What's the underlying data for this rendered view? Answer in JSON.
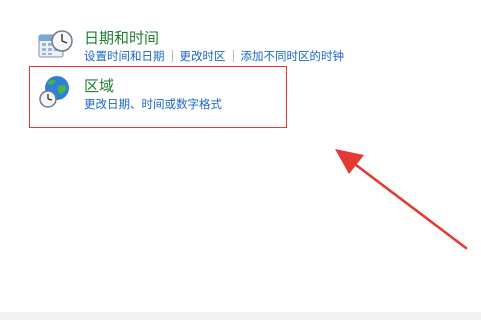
{
  "datetime": {
    "title": "日期和时间",
    "icon": "calendar-clock-icon",
    "links": [
      "设置时间和日期",
      "更改时区",
      "添加不同时区的时钟"
    ]
  },
  "region": {
    "title": "区域",
    "icon": "globe-clock-icon",
    "links": [
      "更改日期、时间或数字格式"
    ]
  },
  "colors": {
    "title_green": "#1e7d2e",
    "link_blue": "#1a66c8",
    "highlight_red": "#e53935"
  }
}
